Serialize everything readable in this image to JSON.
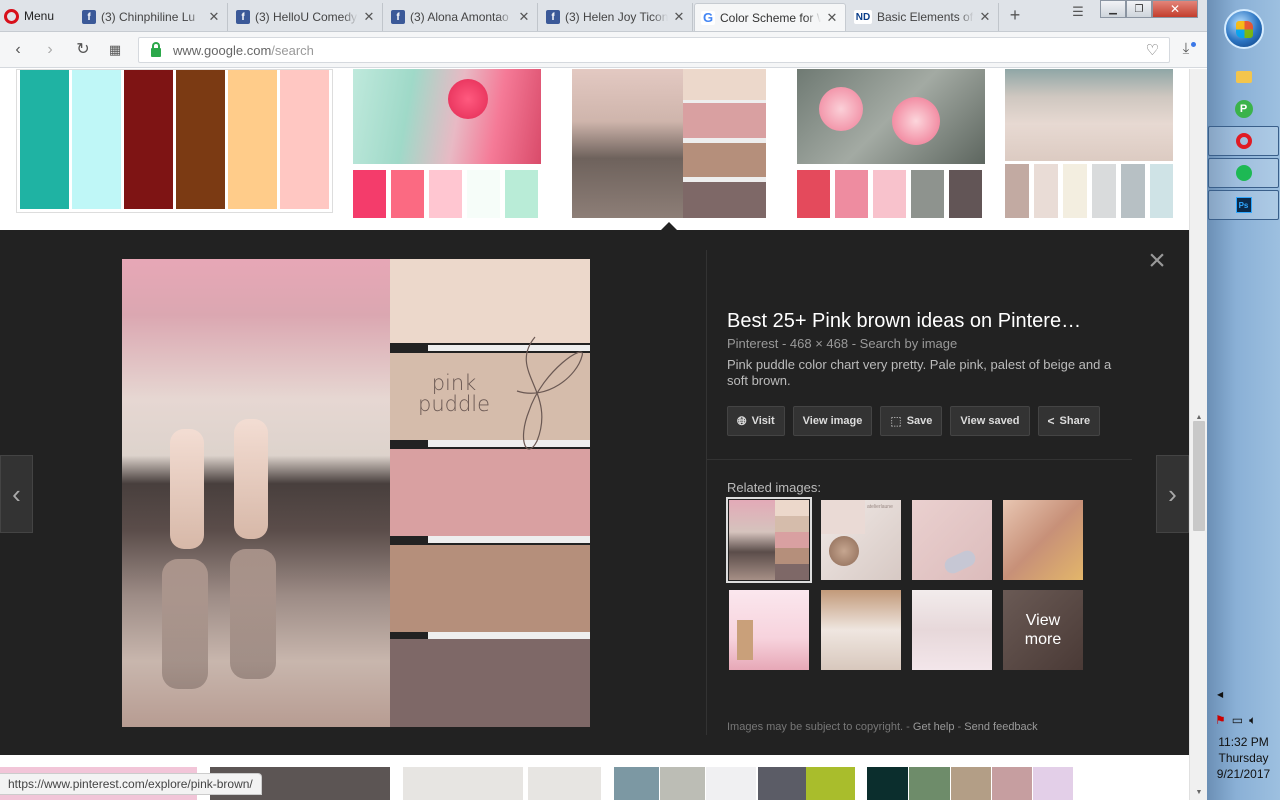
{
  "browser": {
    "menu_label": "Menu",
    "tabs": [
      {
        "title": "(3) Chinphiline Lu",
        "icon": "facebook-icon",
        "active": false
      },
      {
        "title": "(3) HelloU Comedy",
        "icon": "facebook-icon",
        "active": false
      },
      {
        "title": "(3) Alona Amontao",
        "icon": "facebook-icon",
        "active": false
      },
      {
        "title": "(3) Helen Joy Ticon",
        "icon": "facebook-icon",
        "active": false
      },
      {
        "title": "Color Scheme for W",
        "icon": "google-icon",
        "active": true
      },
      {
        "title": "Basic Elements of C",
        "icon": "nd-icon",
        "active": false
      }
    ],
    "url_domain": "www.google.com",
    "url_path": "/search"
  },
  "top_strip": {
    "thumb1_colors": [
      "#1fb3a3",
      "#bff7f7",
      "#7e1414",
      "#7b3a13",
      "#ffcc8a",
      "#ffc7c2"
    ],
    "thumb2_colors": [
      "#f43c6b",
      "#fb6a82",
      "#ffc6d1",
      "#f6fdf9",
      "#b9ecd7"
    ],
    "thumb4_colors": [
      "#e44a5c",
      "#ee8ca0",
      "#f8c2cc",
      "#8e938e",
      "#625556"
    ],
    "thumb5_colors": [
      "#c2aaa2",
      "#e9dcd6",
      "#f3eee0",
      "#d9dbdc",
      "#b7c0c4",
      "#cfe3e6"
    ]
  },
  "viewer": {
    "title": "Best 25+ Pink brown ideas on Pintere…",
    "source": "Pinterest",
    "dimensions": "468 × 468",
    "search_by_image": "Search by image",
    "description": "Pink puddle color chart very pretty. Pale pink, palest of beige and a soft brown.",
    "image_text": [
      "pink",
      "puddle"
    ],
    "palette": [
      "#ecd8cb",
      "#d5bcab",
      "#d9a0a1",
      "#b58f7b",
      "#7e6867"
    ],
    "actions": [
      {
        "label": "Visit",
        "icon": "globe-icon"
      },
      {
        "label": "View image",
        "icon": ""
      },
      {
        "label": "Save",
        "icon": "bookmark-icon"
      },
      {
        "label": "View saved",
        "icon": ""
      },
      {
        "label": "Share",
        "icon": "share-icon"
      }
    ],
    "related_label": "Related images:",
    "view_more": [
      "View",
      "more"
    ],
    "related_thumb_text": "atelierlaune",
    "footer": {
      "copyright": "Images may be subject to copyright.",
      "help": "Get help",
      "feedback": "Send feedback"
    }
  },
  "bottom_strip": {
    "colors": [
      "#f2c5d8",
      "#5c5554",
      "#e7e5e2",
      "#7c98a3",
      "#bcbdb5",
      "#f0f0f2",
      "#5b5c66",
      "#a9bd2c",
      "#0b2e2d",
      "#6e8c6a",
      "#b39e86",
      "#c69ea0",
      "#e3cfe8"
    ]
  },
  "status_url": "https://www.pinterest.com/explore/pink-brown/",
  "taskbar": {
    "time": "11:32 PM",
    "day": "Thursday",
    "date": "9/21/2017"
  }
}
